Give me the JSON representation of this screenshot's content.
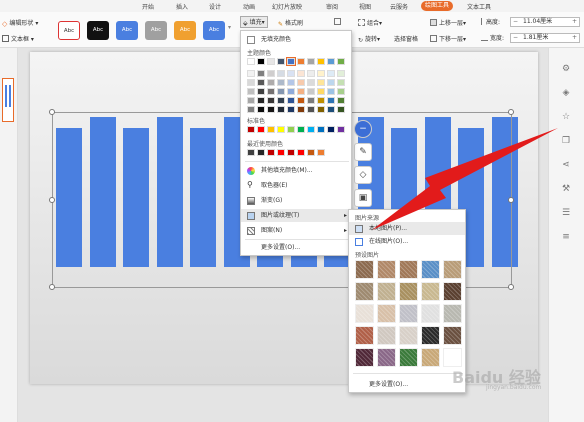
{
  "tabs": [
    {
      "label": "开始"
    },
    {
      "label": "插入"
    },
    {
      "label": "设计"
    },
    {
      "label": "动画"
    },
    {
      "label": "幻灯片放映"
    },
    {
      "label": "审阅"
    },
    {
      "label": "视图"
    },
    {
      "label": "云服务"
    },
    {
      "label": "绘图工具"
    },
    {
      "label": "文本工具"
    }
  ],
  "ribbon": {
    "edit_shape": "编辑形状",
    "text_box": "文本框",
    "style_abc": "Abc",
    "fill": "填充",
    "format_brush": "格式刷",
    "combine": "组合",
    "rotate": "旋转",
    "select_pane": "选择窗格",
    "bring_forward": "上移一层",
    "send_backward": "下移一层",
    "height_label": "高度:",
    "height_value": "11.04厘米",
    "width_label": "宽度:",
    "width_value": "1.81厘米",
    "minus": "−",
    "plus": "+"
  },
  "fill_menu": {
    "no_fill": "无填充颜色",
    "theme_colors": "主题颜色",
    "standard_colors": "标准色",
    "recent_colors": "最近使用颜色",
    "more_fill_colors": "其他填充颜色(M)...",
    "eyedropper": "取色器(E)",
    "gradient": "渐变(G)",
    "picture_texture": "图片或纹理(T)",
    "pattern": "图案(N)",
    "more_settings": "更多设置(O)..."
  },
  "picture_menu": {
    "source_title": "图片来源",
    "local_picture": "本地图片(P)...",
    "online_picture": "在线图片(O)...",
    "preset_title": "预设图片",
    "more_settings": "更多设置(O)..."
  },
  "theme_palette": [
    [
      "#ffffff",
      "#000000",
      "#e7e6e6",
      "#44546a",
      "#4472c4",
      "#ed7d31",
      "#a5a5a5",
      "#ffc000",
      "#5b9bd5",
      "#70ad47"
    ],
    [
      "#f2f2f2",
      "#808080",
      "#d0cece",
      "#d6dce4",
      "#d9e2f3",
      "#fbe5d5",
      "#ededed",
      "#fff2cc",
      "#deebf6",
      "#e2efd9"
    ],
    [
      "#d9d9d9",
      "#595959",
      "#aeabab",
      "#adb9ca",
      "#b4c6e7",
      "#f7caac",
      "#dbdbdb",
      "#fee599",
      "#bdd7ee",
      "#c5e0b3"
    ],
    [
      "#bfbfbf",
      "#404040",
      "#757171",
      "#8496b0",
      "#8eaadb",
      "#f4b183",
      "#c9c9c9",
      "#ffd965",
      "#9cc3e5",
      "#a8d08d"
    ],
    [
      "#a6a6a6",
      "#262626",
      "#3a3838",
      "#323f4f",
      "#2f5496",
      "#c45911",
      "#7b7b7b",
      "#bf8f00",
      "#2e75b5",
      "#538135"
    ],
    [
      "#7f7f7f",
      "#0d0d0d",
      "#171616",
      "#222a35",
      "#1f3864",
      "#823b0b",
      "#525252",
      "#7f6000",
      "#1e4e79",
      "#375623"
    ]
  ],
  "standard_palette": [
    "#c00000",
    "#ff0000",
    "#ffc000",
    "#ffff00",
    "#92d050",
    "#00b050",
    "#00b0f0",
    "#0070c0",
    "#002060",
    "#7030a0"
  ],
  "recent_palette": [
    "#404040",
    "#262626",
    "#c00000",
    "#ff0000",
    "#c00000",
    "#ff0000",
    "#c45911",
    "#ed7d31"
  ],
  "textures": [
    [
      "#8b6a4f",
      "#b08868",
      "#a07858",
      "#5a8fc6",
      "#b89c78"
    ],
    [
      "#9e8a70",
      "#c0b090",
      "#a89060",
      "#c8b890",
      "#5a4030"
    ],
    [
      "#e8e0d8",
      "#d8c0a8",
      "#c0c0c8",
      "#e0e0e0",
      "#b8b8b0"
    ],
    [
      "#b06048",
      "#d0c8c0",
      "#d8d0c8",
      "#2a2a2a",
      "#6a5040"
    ],
    [
      "#502838",
      "#8a6888",
      "#3a7a3a",
      "#c8a878",
      "#ffffff"
    ]
  ],
  "bars": [
    {
      "value": 100
    },
    {
      "value": 108
    },
    {
      "value": 100
    },
    {
      "value": 108
    },
    {
      "value": 100
    },
    {
      "value": 108
    },
    {
      "value": 100
    },
    {
      "value": 108
    },
    {
      "value": 100
    },
    {
      "value": 108
    },
    {
      "value": 100
    },
    {
      "value": 108
    },
    {
      "value": 100
    },
    {
      "value": 108
    }
  ],
  "style_colors": [
    "#ffffff",
    "#111111",
    "#4a7fe0",
    "#a0a0a0",
    "#f0a030",
    "#4a7fe0"
  ],
  "accent": "#e86b2a",
  "watermark": "Baidu 经验",
  "watermark_url": "jingyan.baidu.com"
}
